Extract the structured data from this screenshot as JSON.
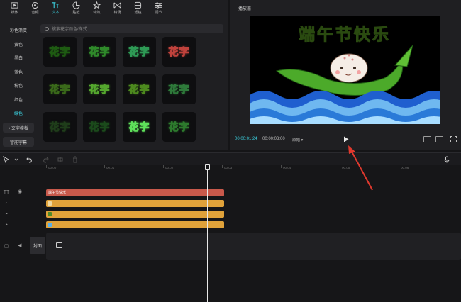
{
  "toolbar": {
    "items": [
      {
        "label": "媒体",
        "icon": "media-icon"
      },
      {
        "label": "音频",
        "icon": "audio-icon"
      },
      {
        "label": "文本",
        "icon": "text-icon",
        "active": true
      },
      {
        "label": "贴纸",
        "icon": "sticker-icon"
      },
      {
        "label": "特效",
        "icon": "effects-icon"
      },
      {
        "label": "转场",
        "icon": "transition-icon"
      },
      {
        "label": "滤镜",
        "icon": "filter-icon"
      },
      {
        "label": "调节",
        "icon": "adjust-icon"
      }
    ]
  },
  "categories": [
    "彩色渐变",
    "黄色",
    "黑白",
    "蓝色",
    "粉色",
    "红色",
    "绿色"
  ],
  "active_category": "绿色",
  "side_buttons": {
    "text_template": "• 文字模板",
    "smart_caption": "智能字幕"
  },
  "search": {
    "placeholder": "搜索花字颜色/样式"
  },
  "preset_tile_text": "花字",
  "preset_tiles": [
    {
      "fill": "#6dd34a",
      "stroke": "#1e5b12"
    },
    {
      "fill": "#d7f0ff",
      "stroke": "#2f8a2a"
    },
    {
      "fill": "#d8f3e3",
      "stroke": "#2e9a55"
    },
    {
      "fill": "#f6f06b",
      "stroke": "#c0423c"
    },
    {
      "fill": "#a6e86a",
      "stroke": "#3a6a1a"
    },
    {
      "fill": "#e8f8d0",
      "stroke": "#55a82e"
    },
    {
      "fill": "#eaf7a8",
      "stroke": "#4d8a1e"
    },
    {
      "fill": "#ffffff",
      "stroke": "#2e7a3a"
    },
    {
      "fill": "#ffffff",
      "stroke": "#1f3d1a"
    },
    {
      "fill": "#b9ffb0",
      "stroke": "#1b4a1b"
    },
    {
      "fill": "#2b2b2b",
      "stroke": "#5ee05a"
    },
    {
      "fill": "#e9ffe1",
      "stroke": "#2d7a2d"
    }
  ],
  "player": {
    "title": "播放器",
    "video_title": "端午节快乐",
    "current_time": "00:00:01:24",
    "total_time": "00:00:03:00",
    "ratio_label": "原始 ▾"
  },
  "timeline": {
    "ruler": [
      "00:00",
      "00:01",
      "00:02",
      "00:03",
      "00:04",
      "00:05",
      "00:06"
    ],
    "text_clip_label": "端午节快乐",
    "cover_label": "封面"
  },
  "colors": {
    "accent": "#3bd1e0",
    "text_clip": "#c8594b",
    "sticker_clip": "#e0a23a",
    "annotation_arrow": "#e0392e"
  }
}
